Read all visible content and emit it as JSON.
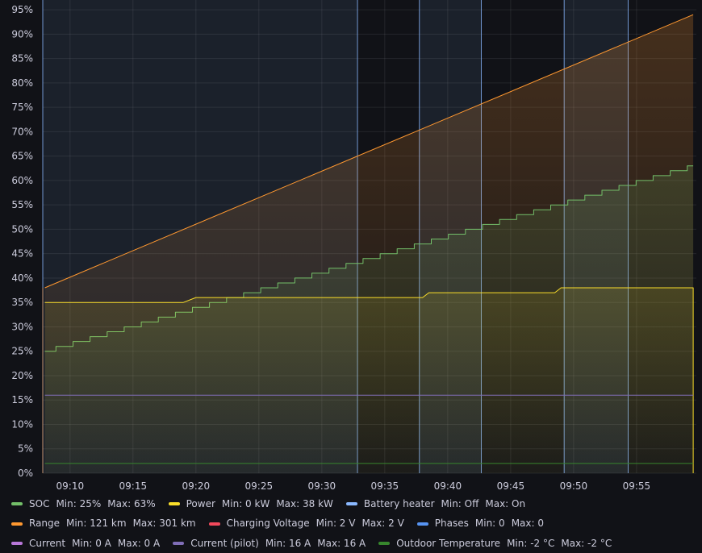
{
  "chart_data": {
    "type": "line",
    "y_axis": {
      "ticks": [
        "0%",
        "5%",
        "10%",
        "15%",
        "20%",
        "25%",
        "30%",
        "35%",
        "40%",
        "45%",
        "50%",
        "55%",
        "60%",
        "65%",
        "70%",
        "75%",
        "80%",
        "85%",
        "90%",
        "95%"
      ],
      "ylim": [
        0,
        97
      ]
    },
    "x_axis": {
      "ticks": [
        "09:10",
        "09:15",
        "09:20",
        "09:25",
        "09:30",
        "09:35",
        "09:40",
        "09:45",
        "09:50",
        "09:55"
      ],
      "xlim_minutes": [
        "09:07:50",
        "09:59:45"
      ]
    },
    "grid": true,
    "colors": {
      "soc": "#73bf69",
      "power": "#fade2a",
      "battery_heater": "#8ab8ff",
      "range": "#ff9830",
      "charging_voltage": "#f2495c",
      "phases": "#5794f2",
      "current": "#b877d9",
      "current_pilot": "#806eb7",
      "outdoor_temperature": "#37872d"
    },
    "series": [
      {
        "key": "soc",
        "name": "SOC",
        "points": [
          [
            "09:08:00",
            25
          ],
          [
            "09:59:30",
            63
          ]
        ],
        "stepped": true
      },
      {
        "key": "range",
        "name": "Range",
        "points": [
          [
            "09:08:00",
            38
          ],
          [
            "09:59:30",
            94
          ]
        ]
      },
      {
        "key": "power",
        "name": "Power",
        "points": [
          [
            "09:08:00",
            35
          ],
          [
            "09:19:00",
            35
          ],
          [
            "09:20:00",
            36
          ],
          [
            "09:38:00",
            36
          ],
          [
            "09:38:30",
            37
          ],
          [
            "09:48:30",
            37
          ],
          [
            "09:49:00",
            38
          ],
          [
            "09:59:30",
            38
          ],
          [
            "09:59:30",
            0
          ]
        ]
      },
      {
        "key": "current_pilot",
        "name": "Current (pilot)",
        "points": [
          [
            "09:08:00",
            16
          ],
          [
            "09:59:30",
            16
          ]
        ]
      },
      {
        "key": "outdoor_temperature",
        "name": "Outdoor Temperature",
        "points": [
          [
            "09:08:00",
            2
          ],
          [
            "09:59:30",
            2
          ]
        ]
      }
    ],
    "battery_heater_events": [
      "09:07:50",
      "09:32:50",
      "09:37:45",
      "09:42:40",
      "09:49:15",
      "09:54:20"
    ],
    "battery_heater_on_intervals": [
      [
        "09:07:50",
        "09:32:50"
      ],
      [
        "09:37:45",
        "09:42:40"
      ],
      [
        "09:49:15",
        "09:54:20"
      ]
    ]
  },
  "legend": [
    {
      "key": "soc",
      "name": "SOC",
      "min": "Min: 25%",
      "max": "Max: 63%"
    },
    {
      "key": "power",
      "name": "Power",
      "min": "Min: 0 kW",
      "max": "Max: 38 kW"
    },
    {
      "key": "battery_heater",
      "name": "Battery heater",
      "min": "Min: Off",
      "max": "Max: On"
    },
    {
      "key": "range",
      "name": "Range",
      "min": "Min: 121 km",
      "max": "Max: 301 km"
    },
    {
      "key": "charging_voltage",
      "name": "Charging Voltage",
      "min": "Min: 2 V",
      "max": "Max: 2 V"
    },
    {
      "key": "phases",
      "name": "Phases",
      "min": "Min: 0",
      "max": "Max: 0"
    },
    {
      "key": "current",
      "name": "Current",
      "min": "Min: 0 A",
      "max": "Max: 0 A"
    },
    {
      "key": "current_pilot",
      "name": "Current (pilot)",
      "min": "Min: 16 A",
      "max": "Max: 16 A"
    },
    {
      "key": "outdoor_temperature",
      "name": "Outdoor Temperature",
      "min": "Min: -2 °C",
      "max": "Max: -2 °C"
    }
  ]
}
